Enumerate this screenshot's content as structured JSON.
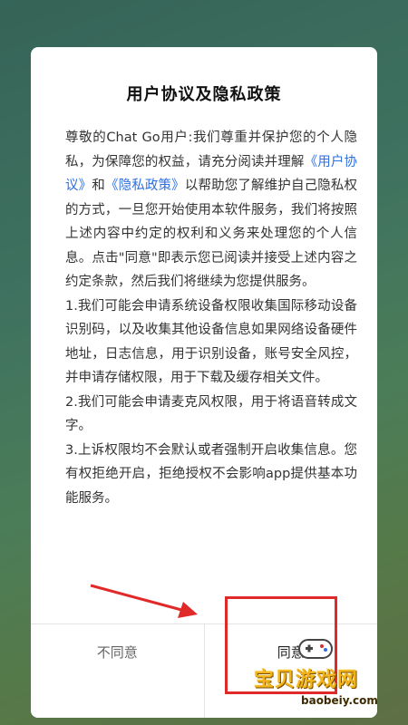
{
  "dialog": {
    "title": "用户协议及隐私政策",
    "intro": {
      "part1": "尊敬的Chat Go用户:我们尊重并保护您的个人隐私，为保障您的权益，请充分阅读并理解",
      "link_agreement": "《用户协议》",
      "and": "和",
      "link_privacy": "《隐私政策》",
      "part2": "以帮助您了解维护自己隐私权的方式，一旦您开始使用本软件服务，我们将按照上述内容中约定的权利和义务来处理您的个人信息。点击\"同意\"即表示您已阅读并接受上述内容之约定条款，然后我们将继续为您提供服务。"
    },
    "clauses": [
      "1.我们可能会申请系统设备权限收集国际移动设备识别码，以及收集其他设备信息如果网络设备硬件地址，日志信息，用于识别设备，账号安全风控，并申请存储权限，用于下载及缓存相关文件。",
      "2.我们可能会申请麦克风权限，用于将语音转成文字。",
      "3.上诉权限均不会默认或者强制开启收集信息。您有权拒绝开启，拒绝授权不会影响app提供基本功能服务。"
    ],
    "decline_label": "不同意",
    "accept_label": "同意"
  },
  "watermark": {
    "title": "宝贝游戏网",
    "url": "baobeiy.com"
  },
  "colors": {
    "link": "#2f6fe0",
    "annotation": "#e02a2a",
    "watermark": "#f2b41a"
  }
}
